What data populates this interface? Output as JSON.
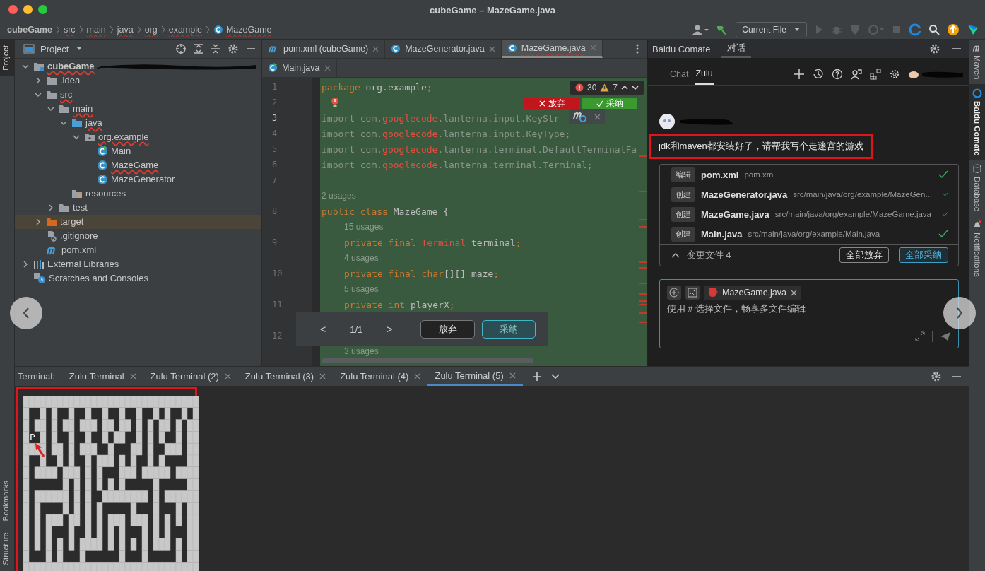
{
  "window": {
    "title": "cubeGame – MazeGame.java"
  },
  "breadcrumbs": [
    {
      "label": "cubeGame",
      "kind": "project"
    },
    {
      "label": "src",
      "kind": "folder"
    },
    {
      "label": "main",
      "kind": "folder"
    },
    {
      "label": "java",
      "kind": "folder"
    },
    {
      "label": "org",
      "kind": "folder"
    },
    {
      "label": "example",
      "kind": "folder"
    },
    {
      "label": "MazeGame",
      "kind": "class"
    }
  ],
  "toolbar": {
    "run_config": "Current File"
  },
  "left_tools": [
    {
      "label": "Project",
      "selected": true
    },
    {
      "label": "Bookmarks",
      "selected": false
    },
    {
      "label": "Structure",
      "selected": false
    }
  ],
  "project_panel": {
    "title": "Project",
    "tree": [
      {
        "label": "cubeGame",
        "kind": "module",
        "error": true,
        "selected": false,
        "expanded": true,
        "children": [
          {
            "label": ".idea",
            "kind": "folder",
            "error": false,
            "selected": false,
            "expanded": false
          },
          {
            "label": "src",
            "kind": "folder",
            "error": true,
            "selected": false,
            "expanded": true,
            "children": [
              {
                "label": "main",
                "kind": "folder",
                "error": true,
                "selected": false,
                "expanded": true,
                "children": [
                  {
                    "label": "java",
                    "kind": "source",
                    "error": true,
                    "selected": false,
                    "expanded": true,
                    "children": [
                      {
                        "label": "org.example",
                        "kind": "package",
                        "error": true,
                        "selected": false,
                        "expanded": true,
                        "children": [
                          {
                            "label": "Main",
                            "kind": "main-class",
                            "error": false,
                            "selected": false
                          },
                          {
                            "label": "MazeGame",
                            "kind": "class",
                            "error": true,
                            "selected": false
                          },
                          {
                            "label": "MazeGenerator",
                            "kind": "class",
                            "error": false,
                            "selected": false
                          }
                        ]
                      }
                    ]
                  },
                  {
                    "label": "resources",
                    "kind": "resources",
                    "error": false,
                    "selected": false
                  }
                ]
              },
              {
                "label": "test",
                "kind": "folder",
                "error": false,
                "selected": false,
                "expanded": false
              }
            ]
          },
          {
            "label": "target",
            "kind": "excluded",
            "error": false,
            "selected": true,
            "expanded": false
          },
          {
            "label": ".gitignore",
            "kind": "gitignore",
            "error": false,
            "selected": false
          },
          {
            "label": "pom.xml",
            "kind": "maven",
            "error": false,
            "selected": false
          }
        ]
      },
      {
        "label": "External Libraries",
        "kind": "libraries",
        "error": false,
        "selected": false,
        "expanded": false
      },
      {
        "label": "Scratches and Consoles",
        "kind": "scratches",
        "error": false,
        "selected": false
      }
    ]
  },
  "editor": {
    "tab_rows": [
      [
        {
          "label": "pom.xml (cubeGame)",
          "kind": "maven",
          "selected": false,
          "error": false
        },
        {
          "label": "MazeGenerator.java",
          "kind": "class",
          "selected": false,
          "error": false
        },
        {
          "label": "MazeGame.java",
          "kind": "class",
          "selected": true,
          "error": true
        }
      ],
      [
        {
          "label": "Main.java",
          "kind": "main-class",
          "selected": false,
          "error": false
        }
      ]
    ],
    "inspections": {
      "errors": "30",
      "warnings": "7"
    },
    "diff_actions": [
      {
        "kind": "reject",
        "label": "放弃"
      },
      {
        "kind": "accept",
        "label": "采纳"
      }
    ],
    "lines": [
      {
        "kind": "code",
        "number": "1",
        "current": false,
        "indented": false,
        "bulb": false,
        "tokens": [
          {
            "kind": "keyword",
            "text": "package"
          },
          {
            "kind": "plain",
            "text": " org.example"
          },
          {
            "kind": "keyword",
            "text": ";"
          }
        ]
      },
      {
        "kind": "code",
        "number": "2",
        "current": false,
        "indented": false,
        "bulb": true
      },
      {
        "kind": "code",
        "number": "3",
        "current": true,
        "indented": false,
        "bulb": false,
        "tokens": [
          {
            "kind": "dim",
            "text": "import com."
          },
          {
            "kind": "error",
            "text": "googlecode"
          },
          {
            "kind": "dim",
            "text": ".lanterna.input.KeyStr"
          }
        ]
      },
      {
        "kind": "code",
        "number": "4",
        "current": false,
        "indented": false,
        "bulb": false,
        "tokens": [
          {
            "kind": "dim",
            "text": "import com."
          },
          {
            "kind": "error",
            "text": "googlecode"
          },
          {
            "kind": "dim",
            "text": ".lanterna.input.KeyType;"
          }
        ]
      },
      {
        "kind": "code",
        "number": "5",
        "current": false,
        "indented": false,
        "bulb": false,
        "tokens": [
          {
            "kind": "dim",
            "text": "import com."
          },
          {
            "kind": "error",
            "text": "googlecode"
          },
          {
            "kind": "dim",
            "text": ".lanterna.terminal.DefaultTerminalFa"
          }
        ]
      },
      {
        "kind": "code",
        "number": "6",
        "current": false,
        "indented": false,
        "bulb": false,
        "tokens": [
          {
            "kind": "dim",
            "text": "import com."
          },
          {
            "kind": "error",
            "text": "googlecode"
          },
          {
            "kind": "dim",
            "text": ".lanterna.terminal.Terminal;"
          }
        ]
      },
      {
        "kind": "code",
        "number": "7",
        "current": false,
        "indented": false,
        "bulb": false
      },
      {
        "kind": "hint",
        "text": "2 usages",
        "indented": false
      },
      {
        "kind": "code",
        "number": "8",
        "current": false,
        "indented": false,
        "bulb": false,
        "tokens": [
          {
            "kind": "keyword",
            "text": "public class "
          },
          {
            "kind": "plain",
            "text": "MazeGame {"
          }
        ]
      },
      {
        "kind": "hint",
        "text": "15 usages",
        "indented": true
      },
      {
        "kind": "code",
        "number": "9",
        "current": false,
        "indented": true,
        "bulb": false,
        "tokens": [
          {
            "kind": "keyword",
            "text": "private final "
          },
          {
            "kind": "error",
            "text": "Terminal"
          },
          {
            "kind": "plain",
            "text": " terminal"
          },
          {
            "kind": "keyword",
            "text": ";"
          }
        ]
      },
      {
        "kind": "hint",
        "text": "4 usages",
        "indented": true
      },
      {
        "kind": "code",
        "number": "10",
        "current": false,
        "indented": true,
        "bulb": false,
        "tokens": [
          {
            "kind": "keyword",
            "text": "private final char"
          },
          {
            "kind": "plain",
            "text": "[][] maze"
          },
          {
            "kind": "keyword",
            "text": ";"
          }
        ]
      },
      {
        "kind": "hint",
        "text": "5 usages",
        "indented": true
      },
      {
        "kind": "code",
        "number": "11",
        "current": false,
        "indented": true,
        "bulb": false,
        "tokens": [
          {
            "kind": "keyword",
            "text": "private int "
          },
          {
            "kind": "plain",
            "text": "playerX"
          },
          {
            "kind": "keyword",
            "text": ";"
          }
        ]
      },
      {
        "kind": "hint",
        "indented": true
      },
      {
        "kind": "code",
        "number": "12",
        "current": false,
        "indented": true,
        "bulb": false
      },
      {
        "kind": "hint",
        "text": "3 usages",
        "indented": true
      }
    ],
    "diff_popup": {
      "prev": "<",
      "counter": "1/1",
      "next": ">",
      "buttons": [
        {
          "kind": "reject",
          "label": "放弃"
        },
        {
          "kind": "accept",
          "label": "采纳"
        }
      ]
    }
  },
  "comate": {
    "title": "Baidu Comate",
    "tabs": [
      {
        "label": "对话",
        "selected": true
      }
    ],
    "subtabs": [
      {
        "label": "Chat",
        "selected": false
      },
      {
        "label": "Zulu",
        "selected": true
      }
    ],
    "message": "jdk和maven都安装好了，请帮我写个走迷宫的游戏",
    "changes": [
      {
        "action": "编辑",
        "name": "pom.xml",
        "path": "pom.xml",
        "done": true
      },
      {
        "action": "创建",
        "name": "MazeGenerator.java",
        "path": "src/main/java/org/example/MazeGen...",
        "done": true
      },
      {
        "action": "创建",
        "name": "MazeGame.java",
        "path": "src/main/java/org/example/MazeGame.java",
        "done": true
      },
      {
        "action": "创建",
        "name": "Main.java",
        "path": "src/main/java/org/example/Main.java",
        "done": true
      }
    ],
    "summary": "变更文件 4",
    "expanded": true,
    "buttons": [
      {
        "kind": "reject",
        "label": "全部放弃"
      },
      {
        "kind": "accept",
        "label": "全部采纳"
      }
    ],
    "input": {
      "chip": "MazeGame.java",
      "placeholder": "使用 # 选择文件，畅享多文件编辑"
    }
  },
  "right_tools": [
    {
      "label": "Maven",
      "kind": "maven",
      "selected": false
    },
    {
      "label": "Baidu Comate",
      "kind": "comate",
      "selected": true
    },
    {
      "label": "Database",
      "kind": "database",
      "selected": false
    },
    {
      "label": "Notifications",
      "kind": "notifications",
      "selected": false
    }
  ],
  "terminal": {
    "label": "Terminal:",
    "tabs": [
      {
        "label": "Zulu Terminal",
        "selected": false
      },
      {
        "label": "Zulu Terminal (2)",
        "selected": false
      },
      {
        "label": "Zulu Terminal (3)",
        "selected": false
      },
      {
        "label": "Zulu Terminal (4)",
        "selected": false
      },
      {
        "label": "Zulu Terminal (5)",
        "selected": true
      }
    ],
    "player_marker": "P"
  }
}
